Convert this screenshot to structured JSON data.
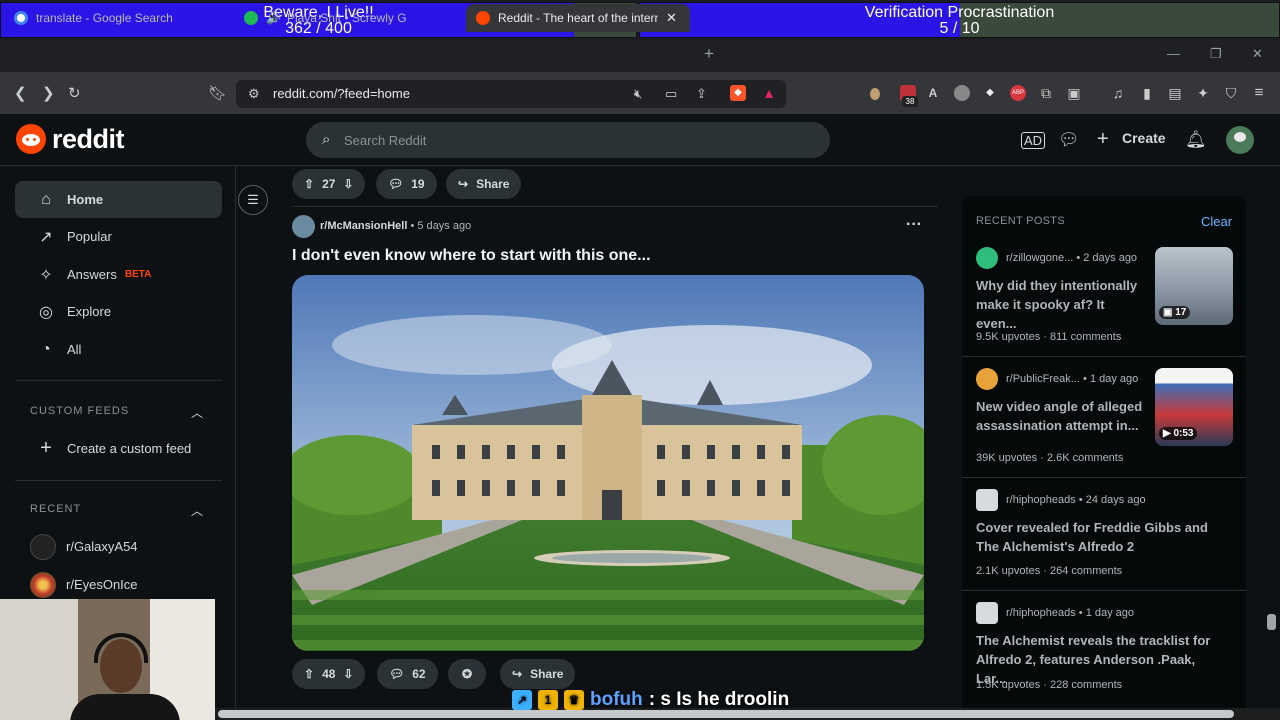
{
  "overlay": {
    "bar1": {
      "title": "Beware, I Live!!",
      "progress": "362 / 400",
      "fraction": 0.905
    },
    "bar2": {
      "title": "Verification Procrastination",
      "progress": "5 / 10",
      "fraction": 0.5
    }
  },
  "browser": {
    "tabs": [
      {
        "label": "translate - Google Search",
        "favicon_color": "#4285f4"
      },
      {
        "label": "Playa Shit • Screwly G",
        "favicon_color": "#1db954"
      },
      {
        "label": "Reddit - The heart of the interne",
        "favicon_color": "#ff4500"
      }
    ],
    "url": "reddit.com/?feed=home",
    "ext_badge_a": "38",
    "ext_badge_b": "ABP"
  },
  "header": {
    "logo": "reddit",
    "search_placeholder": "Search Reddit",
    "create_label": "Create"
  },
  "sidebar": {
    "nav": [
      {
        "label": "Home",
        "icon": "home-icon"
      },
      {
        "label": "Popular",
        "icon": "popular-icon"
      },
      {
        "label": "Answers",
        "icon": "answers-icon",
        "badge": "BETA"
      },
      {
        "label": "Explore",
        "icon": "explore-icon"
      },
      {
        "label": "All",
        "icon": "all-icon"
      }
    ],
    "custom_feeds_heading": "CUSTOM FEEDS",
    "create_feed_label": "Create a custom feed",
    "recent_heading": "RECENT",
    "recent": [
      {
        "label": "r/GalaxyA54"
      },
      {
        "label": "r/EyesOnIce"
      }
    ]
  },
  "feed": {
    "prev_post": {
      "votes": "27",
      "comments": "19",
      "share": "Share"
    },
    "post": {
      "subreddit": "r/McMansionHell",
      "age": "5 days ago",
      "title": "I don't even know where to start with this one...",
      "votes": "48",
      "comments": "62",
      "share": "Share"
    }
  },
  "recent_posts": {
    "heading": "RECENT POSTS",
    "clear": "Clear",
    "items": [
      {
        "sub": "r/zillowgone...",
        "age": "2 days ago",
        "title": "Why did they intentionally make it spooky af? It even...",
        "upvotes": "9.5K upvotes",
        "comments": "811 comments",
        "thumb_badge": "17",
        "avatar_color": "#2ebd7a"
      },
      {
        "sub": "r/PublicFreak...",
        "age": "1 day ago",
        "title": "New video angle of alleged assassination attempt in...",
        "upvotes": "39K upvotes",
        "comments": "2.6K comments",
        "thumb_badge": "0:53",
        "avatar_color": "#e8a23a"
      },
      {
        "sub": "r/hiphopheads",
        "age": "24 days ago",
        "title": "Cover revealed for Freddie Gibbs and The Alchemist's Alfredo 2",
        "upvotes": "2.1K upvotes",
        "comments": "264 comments",
        "avatar_color": "#d7dadc"
      },
      {
        "sub": "r/hiphopheads",
        "age": "1 day ago",
        "title": "The Alchemist reveals the tracklist for Alfredo 2, features Anderson .Paak, Lar...",
        "upvotes": "1.5K upvotes",
        "comments": "228 comments",
        "avatar_color": "#d7dadc"
      }
    ]
  },
  "chat": {
    "user": "bofuh",
    "message": ": s Is he droolin"
  }
}
